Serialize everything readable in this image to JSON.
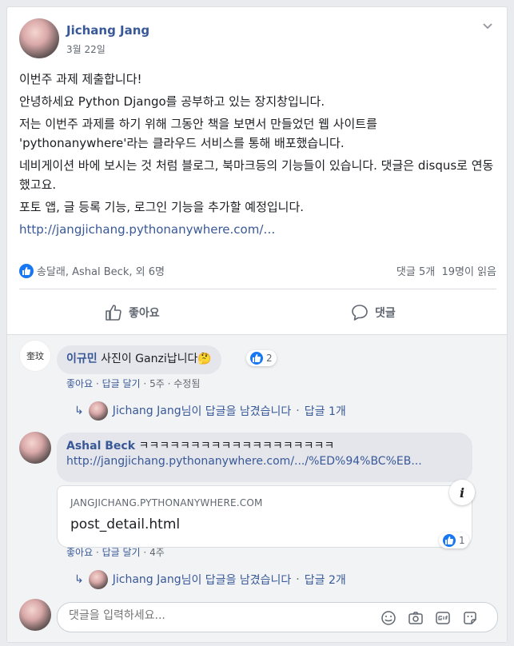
{
  "post": {
    "author": "Jichang Jang",
    "date": "3월 22일",
    "paragraphs": [
      "이번주 과제 제출합니다!",
      "안녕하세요 Python Django를 공부하고 있는 장지창입니다.",
      "저는 이번주 과제를 하기 위해 그동안 책을 보면서 만들었던 웹 사이트를 'pythonanywhere'라는 클라우드 서비스를 통해 배포했습니다.",
      "네비게이션 바에 보시는 것 처럼 블로그, 북마크등의 기능들이 있습니다. 댓글은 disqus로 연동했고요.",
      "포토 앱, 글 등록 기능, 로그인 기능을 추가할 예정입니다."
    ],
    "link": "http://jangjichang.pythonanywhere.com/…"
  },
  "stats": {
    "reactors": "송달래, Ashal Beck, 외 6명",
    "comments": "댓글 5개",
    "views": "19명이 읽음"
  },
  "actions": {
    "like": "좋아요",
    "comment": "댓글"
  },
  "comments": [
    {
      "avatar_label": "奎玟",
      "name": "이규민",
      "text": "사진이 Ganzi납니다🤔",
      "reaction_count": "2",
      "like": "좋아요",
      "reply": "답글 달기",
      "time": "5주",
      "edited": "수정됨",
      "replies_author": "Jichang Jang",
      "replies_text": "님이 답글을 남겼습니다",
      "replies_count": "답글 1개"
    },
    {
      "name": "Ashal Beck",
      "text": "ㅋㅋㅋㅋㅋㅋㅋㅋㅋㅋㅋㅋㅋㅋㅋㅋㅋㅋㅋ",
      "link": "http://jangjichang.pythonanywhere.com/.../%ED%94%BC%EB...",
      "preview_domain": "JANGJICHANG.PYTHONANYWHERE.COM",
      "preview_title": "post_detail.html",
      "info_glyph": "i",
      "reaction_count": "1",
      "like": "좋아요",
      "reply": "답글 달기",
      "time": "4주",
      "replies_author": "Jichang Jang",
      "replies_text": "님이 답글을 남겼습니다",
      "replies_count": "답글 2개"
    }
  ],
  "composer": {
    "placeholder": "댓글을 입력하세요..."
  },
  "separator": "·",
  "colors": {
    "link": "#385898",
    "like_blue": "#1877f2",
    "muted": "#606770"
  }
}
